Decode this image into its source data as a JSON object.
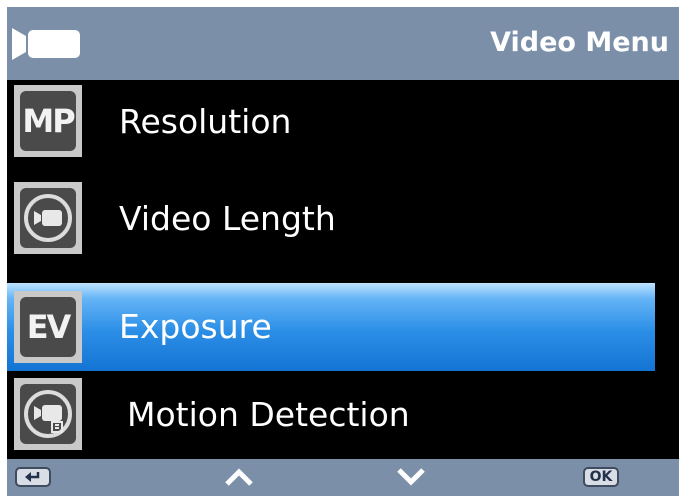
{
  "header": {
    "title": "Video Menu",
    "icon": "video-camera-icon"
  },
  "menu": {
    "items": [
      {
        "label": "Resolution",
        "icon": "mp-icon",
        "icon_text": "MP",
        "selected": false
      },
      {
        "label": "Video Length",
        "icon": "camera-circle-icon",
        "icon_text": "",
        "selected": false
      },
      {
        "label": "Exposure",
        "icon": "ev-icon",
        "icon_text": "EV",
        "selected": true
      },
      {
        "label": "Motion Detection",
        "icon": "motion-detection-icon",
        "icon_text": "",
        "selected": false
      }
    ]
  },
  "footer": {
    "back": "back-icon",
    "up": "chevron-up-icon",
    "down": "chevron-down-icon",
    "ok_label": "OK"
  },
  "colors": {
    "bar": "#7b8fa8",
    "background": "#000000",
    "selection": "#2b8ee6",
    "text": "#ffffff"
  }
}
